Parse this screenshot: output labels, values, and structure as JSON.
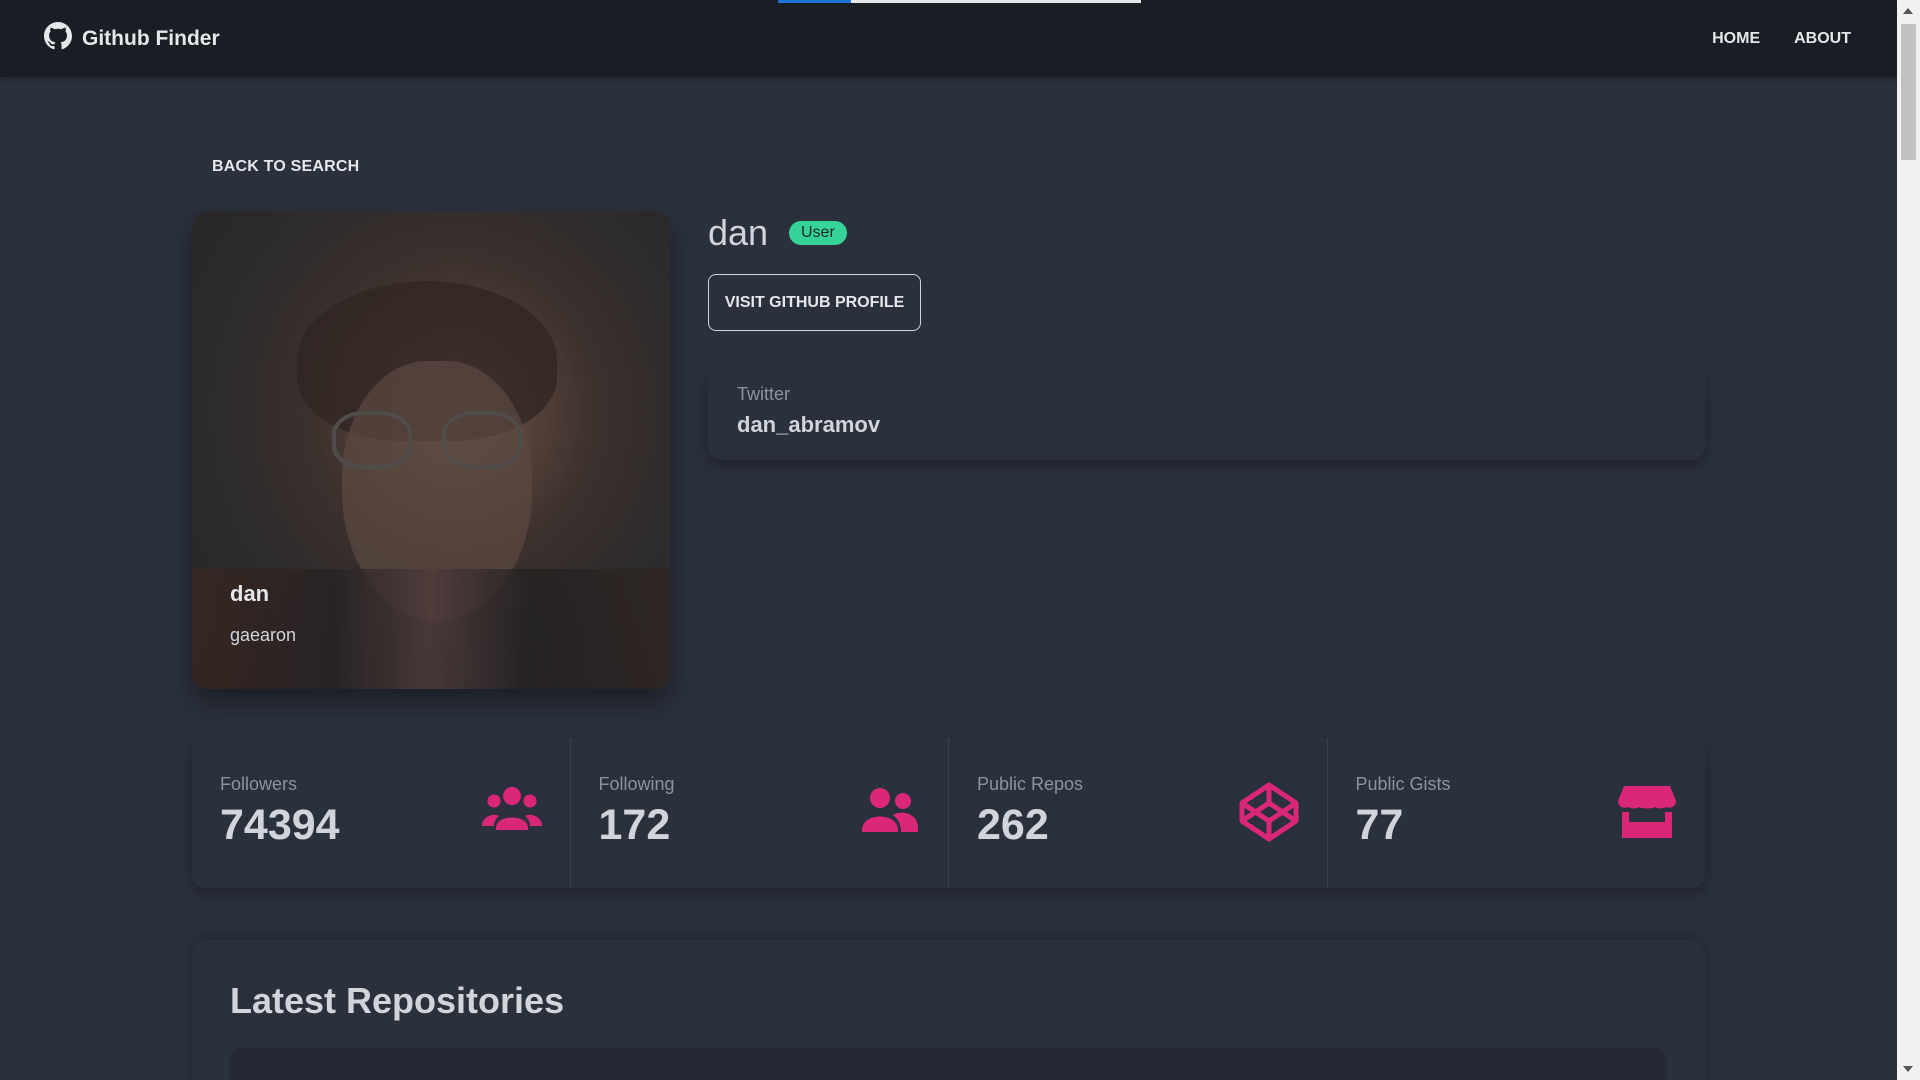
{
  "navbar": {
    "brand": "Github Finder",
    "links": [
      "HOME",
      "ABOUT"
    ],
    "progress": 0.2
  },
  "back_label": "BACK TO SEARCH",
  "profile": {
    "name": "dan",
    "login": "gaearon",
    "type_badge": "User",
    "visit_label": "VISIT GITHUB PROFILE",
    "twitter_label": "Twitter",
    "twitter_value": "dan_abramov"
  },
  "stats": [
    {
      "title": "Followers",
      "value": "74394",
      "icon": "users-icon"
    },
    {
      "title": "Following",
      "value": "172",
      "icon": "user-friends-icon"
    },
    {
      "title": "Public Repos",
      "value": "262",
      "icon": "codepen-icon"
    },
    {
      "title": "Public Gists",
      "value": "77",
      "icon": "store-icon"
    }
  ],
  "repos": {
    "title": "Latest Repositories"
  },
  "colors": {
    "accent": "#db2777",
    "badge": "#36d399",
    "background": "#2a303c",
    "navbar": "#191d24"
  }
}
